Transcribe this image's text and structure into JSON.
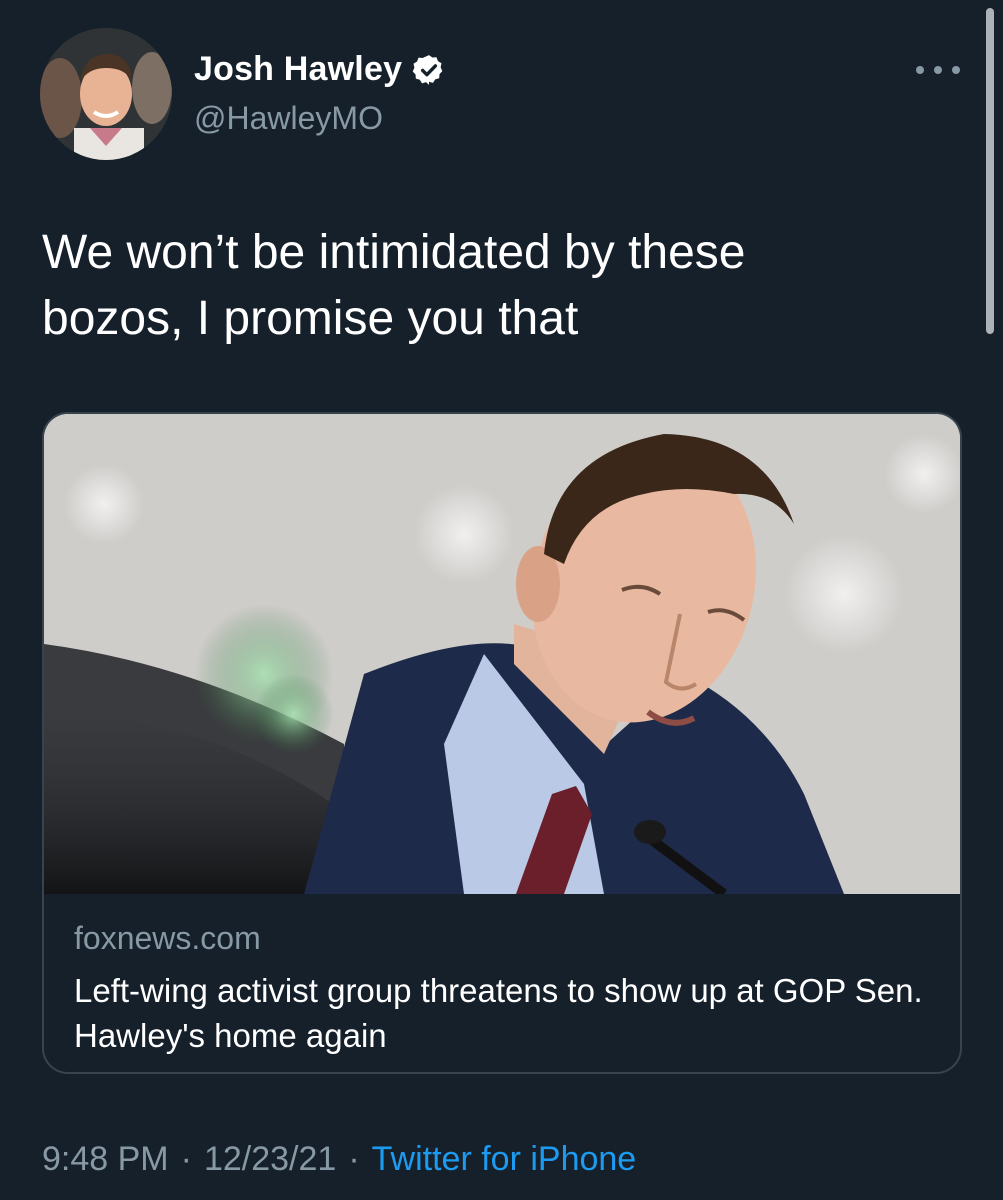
{
  "author": {
    "name": "Josh Hawley",
    "handle": "@HawleyMO",
    "verified": true
  },
  "tweet": {
    "text_line1": "We won’t be intimidated by these",
    "text_line2": "bozos, I promise you that"
  },
  "card": {
    "domain": "foxnews.com",
    "title": "Left-wing activist group threatens to show up at GOP Sen. Hawley's home again"
  },
  "meta": {
    "time": "9:48 PM",
    "separator": "·",
    "date": "12/23/21",
    "source": "Twitter for iPhone"
  },
  "colors": {
    "background": "#15202b",
    "secondary_text": "#8899a6",
    "link": "#1d9bf0",
    "verified_badge": "#ffffff"
  },
  "icons": {
    "verified": "verified-badge-icon",
    "more": "more-horizontal-icon"
  }
}
